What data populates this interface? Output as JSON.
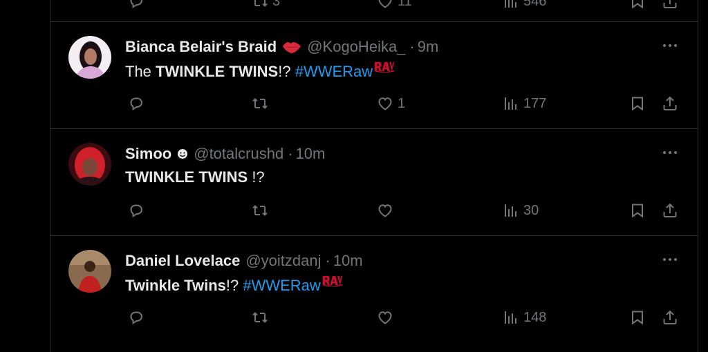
{
  "top_action_counts": {
    "retweets": "3",
    "likes": "11",
    "views": "546"
  },
  "tweets": [
    {
      "name": "Bianca Belair's Braid",
      "name_emoji": "lips-emoji",
      "handle": "@KogoHeika_",
      "separator": "·",
      "time": "9m",
      "text_parts": {
        "a": "The ",
        "b": "TWINKLE TWINS",
        "c": "!? ",
        "hashtag": "#WWERaw"
      },
      "hashtag_emoji": "raw-logo",
      "likes": "1",
      "views": "177"
    },
    {
      "name": "Simoo",
      "name_emoji": "smiley-emoji",
      "handle": "@totalcrushd",
      "separator": "·",
      "time": "10m",
      "text_parts": {
        "b": "TWINKLE TWINS",
        "c": " !?"
      },
      "likes": "",
      "views": "30"
    },
    {
      "name": "Daniel Lovelace",
      "handle": "@yoitzdanj",
      "separator": "·",
      "time": "10m",
      "text_parts": {
        "b": "Twinkle Twins",
        "c": "!? ",
        "hashtag": "#WWERaw"
      },
      "hashtag_emoji": "raw-logo",
      "likes": "",
      "views": "148"
    }
  ],
  "colors": {
    "background": "#000000",
    "text": "#e7e9ea",
    "muted": "#71767b",
    "link": "#1d9bf0",
    "divider": "#2f3336",
    "raw_logo": "#c8102e"
  }
}
